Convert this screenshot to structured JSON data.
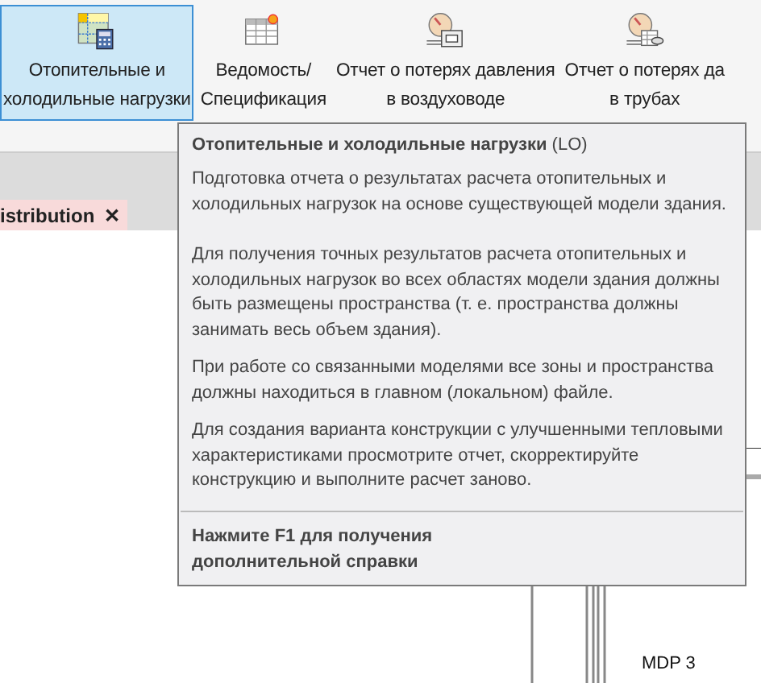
{
  "ribbon": {
    "buttons": [
      {
        "kind": "loads",
        "label": "Отопительные и\nхолодильные нагрузки",
        "selected": true
      },
      {
        "kind": "schedule",
        "label": "Ведомость/\nСпецификация",
        "selected": false
      },
      {
        "kind": "duct",
        "label": "Отчет о потерях давления\nв воздуховоде",
        "selected": false
      },
      {
        "kind": "pipe",
        "label": "Отчет о потерях да\nв трубах",
        "selected": false
      }
    ]
  },
  "tabs": [
    {
      "label": "istribution",
      "close": "✕"
    }
  ],
  "tooltip": {
    "title": "**Отопительные и холодильные нагрузки** (LO)",
    "paragraphs": [
      "Подготовка отчета о результатах расчета отопительных и холодильных нагрузок на основе существующей модели здания.",
      "Для получения точных результатов расчета отопительных и холодильных нагрузок во всех областях модели здания должны быть размещены пространства (т. е. пространства должны занимать весь объем здания).",
      "При работе со связанными моделями все зоны и пространства должны находиться в главном (локальном) файле.",
      "Для создания варианта конструкции с улучшенными тепловыми характеристиками просмотрите отчет, скорректируйте конструкцию и выполните расчет заново."
    ],
    "help": "Нажмите F1 для получения дополнительной справки"
  },
  "canvas": {
    "label": "MDP 3"
  }
}
